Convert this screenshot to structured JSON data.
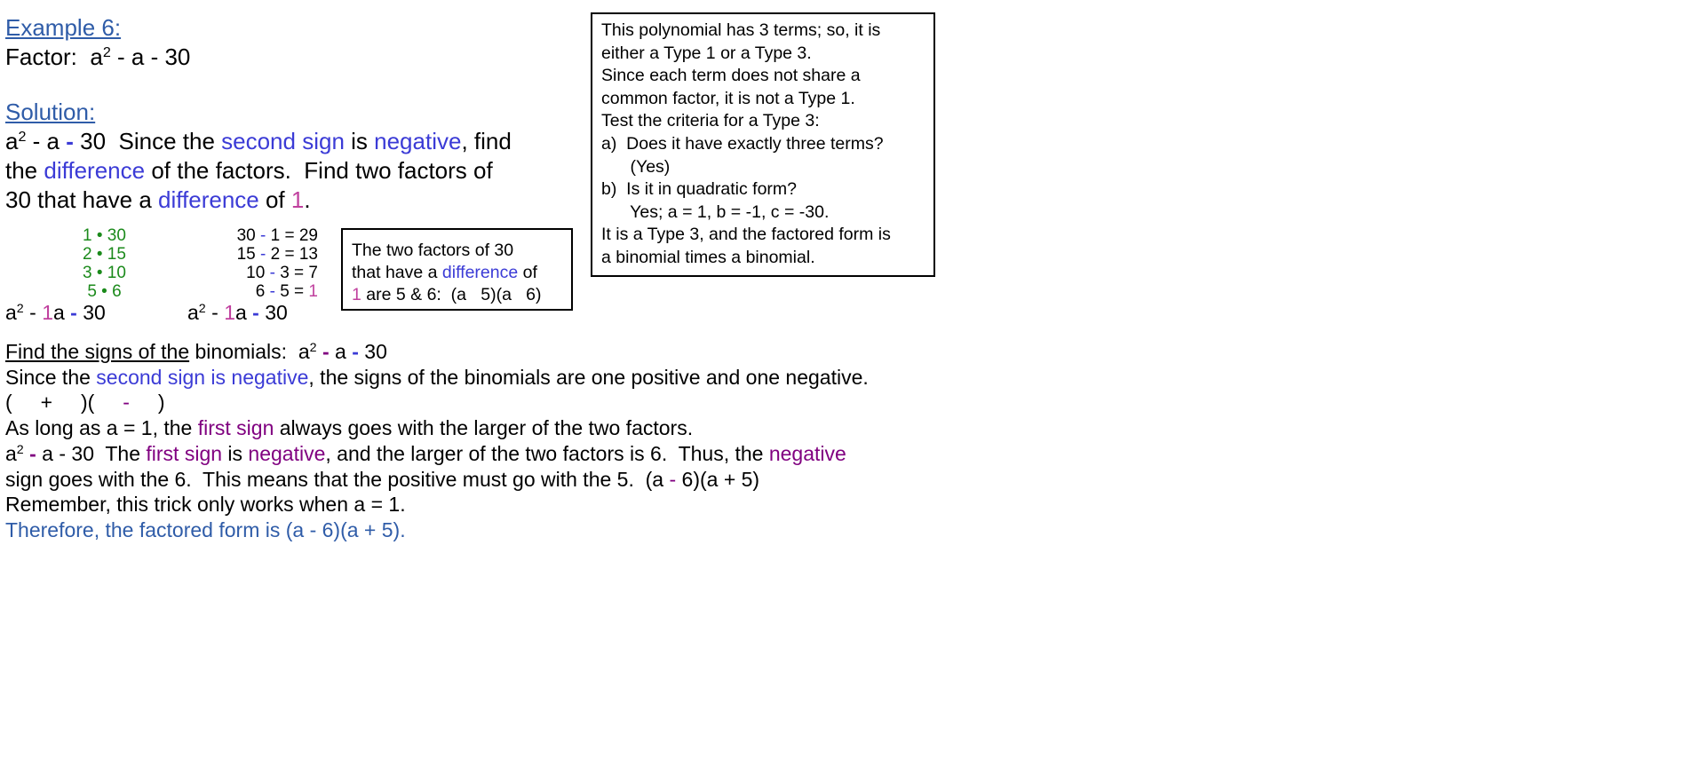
{
  "colors": {
    "heading": "#2f5ca8",
    "blue": "#3b3bd6",
    "pink": "#c0409e",
    "green": "#1b8a1b",
    "purple": "#800080"
  },
  "example_title": "Example 6:",
  "factor_line": [
    {
      "t": "Factor:  a"
    },
    {
      "t": "2",
      "sup": true
    },
    {
      "t": " - a - 30"
    }
  ],
  "solution_title": "Solution:",
  "solution_lines": [
    [
      {
        "t": "a"
      },
      {
        "t": "2",
        "sup": true
      },
      {
        "t": " - a "
      },
      {
        "t": "-",
        "c": "blue",
        "b": true
      },
      {
        "t": " 30  Since the "
      },
      {
        "t": "second sign",
        "c": "blue"
      },
      {
        "t": " is "
      },
      {
        "t": "negative",
        "c": "blue"
      },
      {
        "t": ", find"
      }
    ],
    [
      {
        "t": "the "
      },
      {
        "t": "difference",
        "c": "blue"
      },
      {
        "t": " of the factors.  Find two factors of"
      }
    ],
    [
      {
        "t": "30 that have a "
      },
      {
        "t": "difference",
        "c": "blue"
      },
      {
        "t": " of "
      },
      {
        "t": "1",
        "c": "pink"
      },
      {
        "t": "."
      }
    ]
  ],
  "factor_pairs": [
    [
      {
        "t": "1 • 30",
        "c": "green"
      }
    ],
    [
      {
        "t": "2 • 15",
        "c": "green"
      }
    ],
    [
      {
        "t": "3 • 10",
        "c": "green"
      }
    ],
    [
      {
        "t": "5 • 6",
        "c": "green"
      }
    ]
  ],
  "differences": [
    [
      {
        "t": "30 "
      },
      {
        "t": "-",
        "c": "blue"
      },
      {
        "t": " 1 = 29"
      }
    ],
    [
      {
        "t": "15 "
      },
      {
        "t": "-",
        "c": "blue"
      },
      {
        "t": " 2 = 13"
      }
    ],
    [
      {
        "t": "10 "
      },
      {
        "t": "-",
        "c": "blue"
      },
      {
        "t": " 3 = 7"
      }
    ],
    [
      {
        "t": "6 "
      },
      {
        "t": "-",
        "c": "blue"
      },
      {
        "t": " 5 = "
      },
      {
        "t": "1",
        "c": "pink"
      }
    ]
  ],
  "expr_left": [
    {
      "t": "a"
    },
    {
      "t": "2",
      "sup": true
    },
    {
      "t": " - "
    },
    {
      "t": "1",
      "c": "pink"
    },
    {
      "t": "a "
    },
    {
      "t": "-",
      "c": "blue",
      "b": true
    },
    {
      "t": " 30"
    }
  ],
  "expr_right": [
    {
      "t": "a"
    },
    {
      "t": "2",
      "sup": true
    },
    {
      "t": " - "
    },
    {
      "t": "1",
      "c": "pink"
    },
    {
      "t": "a "
    },
    {
      "t": "-",
      "c": "blue",
      "b": true
    },
    {
      "t": " 30"
    }
  ],
  "small_box_lines": [
    [
      {
        "t": "The two factors of 30"
      }
    ],
    [
      {
        "t": "that have a "
      },
      {
        "t": "difference",
        "c": "blue"
      },
      {
        "t": " of"
      }
    ],
    [
      {
        "t": "1",
        "c": "pink"
      },
      {
        "t": " are 5 & 6:  (a   5)(a   6)"
      }
    ]
  ],
  "info_box_lines": [
    [
      {
        "t": "This polynomial has 3 terms; so, it is"
      }
    ],
    [
      {
        "t": "either a Type 1 or a Type 3."
      }
    ],
    [
      {
        "t": "Since each term does not share a"
      }
    ],
    [
      {
        "t": "common factor, it is not a Type 1."
      }
    ],
    [
      {
        "t": "Test the criteria for a Type 3:"
      }
    ],
    [
      {
        "t": "a)  Does it have exactly three terms?"
      }
    ],
    [
      {
        "t": "      (Yes)"
      }
    ],
    [
      {
        "t": "b)  Is it in quadratic form?"
      }
    ],
    [
      {
        "t": "      Yes; a = 1, b = -1, c = -30."
      }
    ],
    [
      {
        "t": "It is a Type 3, and the factored form is"
      }
    ],
    [
      {
        "t": "a binomial times a binomial."
      }
    ]
  ],
  "signs_lines": [
    [
      {
        "t": "Find the signs of the",
        "u": true
      },
      {
        "t": " binomials:  a"
      },
      {
        "t": "2",
        "sup": true
      },
      {
        "t": " "
      },
      {
        "t": "-",
        "c": "purple",
        "b": true
      },
      {
        "t": " a "
      },
      {
        "t": "-",
        "c": "blue",
        "b": true
      },
      {
        "t": " 30"
      }
    ],
    [
      {
        "t": "Since the "
      },
      {
        "t": "second sign is negative",
        "c": "blue"
      },
      {
        "t": ", the signs of the binomials are one positive and one negative."
      }
    ],
    [
      {
        "t": "(     +     )(     "
      },
      {
        "t": "-",
        "c": "purple"
      },
      {
        "t": "     )"
      }
    ],
    [
      {
        "t": "As long as a = 1, the "
      },
      {
        "t": "first sign",
        "c": "purple"
      },
      {
        "t": " always goes with the larger of the two factors."
      }
    ],
    [
      {
        "t": "a"
      },
      {
        "t": "2",
        "sup": true
      },
      {
        "t": " "
      },
      {
        "t": "-",
        "c": "purple",
        "b": true
      },
      {
        "t": " a - 30  The "
      },
      {
        "t": "first sign",
        "c": "purple"
      },
      {
        "t": " is "
      },
      {
        "t": "negative",
        "c": "purple"
      },
      {
        "t": ", and the larger of the two factors is 6.  Thus, the "
      },
      {
        "t": "negative",
        "c": "purple"
      }
    ],
    [
      {
        "t": "sign goes with the 6.  This means that the positive must go with the 5.  (a "
      },
      {
        "t": "-",
        "c": "purple"
      },
      {
        "t": " 6)(a + 5)"
      }
    ],
    [
      {
        "t": "Remember, this trick only works when a = 1."
      }
    ],
    [
      {
        "t": "Therefore, the factored form is (a - 6)(a + 5).",
        "c": "steel"
      }
    ]
  ]
}
